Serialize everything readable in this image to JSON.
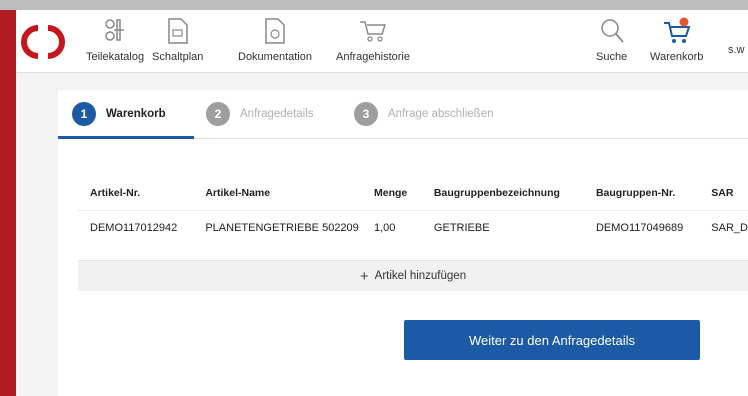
{
  "nav": {
    "items": [
      {
        "label": "Teilekatalog",
        "icon": "parts-catalog-icon"
      },
      {
        "label": "Schaltplan",
        "icon": "wiring-diagram-icon"
      },
      {
        "label": "Dokumentation",
        "icon": "documentation-icon"
      },
      {
        "label": "Anfragehistorie",
        "icon": "request-history-icon"
      }
    ],
    "search_label": "Suche",
    "cart_label": "Warenkorb",
    "user_label": "s.w"
  },
  "steps": [
    {
      "number": "1",
      "label": "Warenkorb"
    },
    {
      "number": "2",
      "label": "Anfragedetails"
    },
    {
      "number": "3",
      "label": "Anfrage abschließen"
    }
  ],
  "table": {
    "columns": [
      "Artikel-Nr.",
      "Artikel-Name",
      "Menge",
      "Baugruppenbezeichnung",
      "Baugruppen-Nr.",
      "SAR"
    ],
    "rows": [
      [
        "DEMO117012942",
        "PLANETENGETRIEBE 502209",
        "1,00",
        "GETRIEBE",
        "DEMO117049689",
        "SAR_D"
      ]
    ]
  },
  "add_article_label": "Artikel hinzufügen",
  "continue_button_label": "Weiter zu den Anfragedetails",
  "colors": {
    "accent": "#1c5aa6",
    "brand_red": "#b31b22",
    "cart_badge": "#e8542a"
  }
}
